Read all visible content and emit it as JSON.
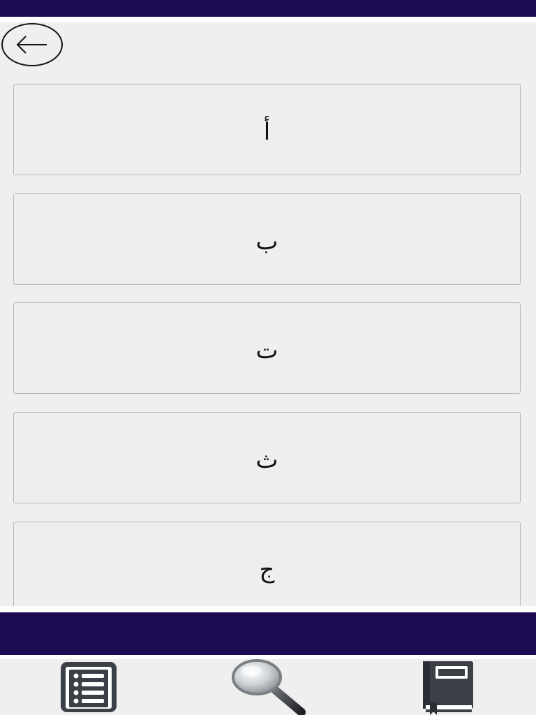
{
  "colors": {
    "bar": "#1c0a52",
    "background": "#efefef",
    "item_border": "#b8b8b8"
  },
  "header": {
    "back_icon": "arrow-left-icon"
  },
  "letters": [
    {
      "label": "أ"
    },
    {
      "label": "ب"
    },
    {
      "label": "ت"
    },
    {
      "label": "ث"
    },
    {
      "label": "ج"
    }
  ],
  "tabbar": {
    "tabs": [
      {
        "icon": "list-icon"
      },
      {
        "icon": "magnifier-icon"
      },
      {
        "icon": "book-icon"
      }
    ]
  }
}
